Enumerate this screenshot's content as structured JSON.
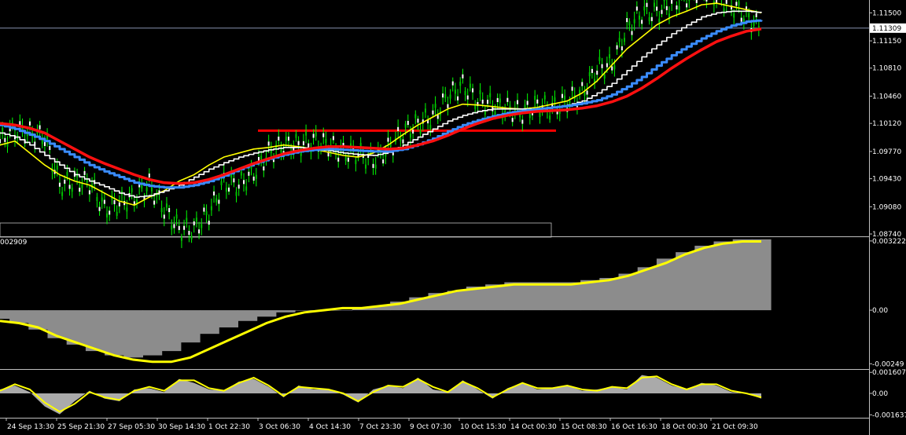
{
  "chart_data": [
    {
      "type": "line",
      "pane": "price",
      "y_ticks": [
        "1.11500",
        "1.11150",
        "1.10810",
        "1.10460",
        "1.10120",
        "1.09770",
        "1.09430",
        "1.09080",
        "1.08740"
      ],
      "y_tick_values": [
        1.115,
        1.1115,
        1.1081,
        1.1046,
        1.1012,
        1.0977,
        1.0943,
        1.0908,
        1.0874
      ],
      "ylim": [
        1.0874,
        1.1166
      ],
      "current_price": "1.11309",
      "current_price_value": 1.11309,
      "horizontal_level": {
        "value": 1.1003,
        "x_from_category": "3 Oct 06:30",
        "x_to_category": "15 Oct 08:30",
        "color": "#ff0000"
      },
      "series": [
        {
          "color": "#00ff00",
          "style": "candles",
          "values": [
            1.099,
            1.1003,
            1.1,
            1.0995,
            1.0935,
            1.094,
            1.0938,
            1.0905,
            1.0912,
            1.092,
            1.0935,
            1.0905,
            1.088,
            1.088,
            1.09,
            1.0938,
            1.0935,
            1.095,
            1.0975,
            1.0985,
            1.0985,
            1.099,
            1.0985,
            1.0975,
            1.0975,
            1.0965,
            1.098,
            1.1,
            1.1012,
            1.102,
            1.1045,
            1.106,
            1.104,
            1.1035,
            1.103,
            1.1025,
            1.1035,
            1.103,
            1.104,
            1.105,
            1.108,
            1.1085,
            1.113,
            1.115,
            1.115,
            1.116,
            1.117,
            1.118,
            1.117,
            1.116,
            1.1145,
            1.113
          ]
        },
        {
          "color": "#ffff00",
          "values": [
            1.0985,
            1.099,
            1.0975,
            1.096,
            1.0948,
            1.094,
            1.0935,
            1.0925,
            1.0915,
            1.091,
            1.092,
            1.0928,
            1.094,
            1.0948,
            1.096,
            1.097,
            1.0975,
            1.098,
            1.0982,
            1.0985,
            1.0983,
            1.098,
            1.0976,
            1.0972,
            1.097,
            1.0975,
            1.0985,
            1.0998,
            1.101,
            1.102,
            1.103,
            1.1036,
            1.1035,
            1.1033,
            1.1031,
            1.103,
            1.1032,
            1.1036,
            1.104,
            1.105,
            1.1065,
            1.1085,
            1.1105,
            1.112,
            1.1135,
            1.1145,
            1.1152,
            1.116,
            1.1162,
            1.1158,
            1.1154,
            1.115
          ]
        },
        {
          "color": "#ffffff",
          "style": "step",
          "values": [
            1.1,
            1.0995,
            1.0985,
            1.0972,
            1.096,
            1.0948,
            1.094,
            1.0933,
            1.0925,
            1.092,
            1.0922,
            1.0928,
            1.0935,
            1.0945,
            1.0955,
            1.0963,
            1.097,
            1.0975,
            1.0979,
            1.0982,
            1.0982,
            1.098,
            1.0978,
            1.0975,
            1.0973,
            1.0972,
            1.0976,
            1.0985,
            1.0995,
            1.1005,
            1.1015,
            1.1022,
            1.1027,
            1.103,
            1.103,
            1.103,
            1.103,
            1.1032,
            1.1035,
            1.104,
            1.105,
            1.1062,
            1.1078,
            1.1095,
            1.111,
            1.1124,
            1.1135,
            1.1145,
            1.115,
            1.1152,
            1.1152,
            1.115
          ]
        },
        {
          "color": "#3a8cff",
          "style": "step",
          "values": [
            1.101,
            1.1005,
            1.0998,
            1.099,
            1.098,
            1.097,
            1.096,
            1.0952,
            1.0945,
            1.0938,
            1.0934,
            1.0932,
            1.0932,
            1.0935,
            1.094,
            1.0947,
            1.0955,
            1.0962,
            1.0968,
            1.0973,
            1.0977,
            1.0979,
            1.098,
            1.0979,
            1.0978,
            1.0977,
            1.0977,
            1.098,
            1.0986,
            1.0993,
            1.1002,
            1.101,
            1.1016,
            1.1021,
            1.1025,
            1.1028,
            1.103,
            1.1032,
            1.1034,
            1.1037,
            1.1041,
            1.1048,
            1.1058,
            1.107,
            1.1084,
            1.1097,
            1.1108,
            1.1118,
            1.1127,
            1.1134,
            1.1139,
            1.1141
          ]
        },
        {
          "color": "#ff1010",
          "values": [
            1.1012,
            1.101,
            1.1006,
            1.1,
            1.099,
            1.098,
            1.097,
            1.0962,
            1.0955,
            1.0948,
            1.0942,
            1.0938,
            1.0937,
            1.0938,
            1.0942,
            1.0948,
            1.0955,
            1.0962,
            1.0968,
            1.0974,
            1.0978,
            1.0981,
            1.0983,
            1.0983,
            1.0982,
            1.0981,
            1.098,
            1.0981,
            1.0985,
            1.099,
            1.0997,
            1.1005,
            1.1012,
            1.1018,
            1.1022,
            1.1025,
            1.1027,
            1.1028,
            1.1029,
            1.1031,
            1.1034,
            1.1039,
            1.1046,
            1.1056,
            1.1068,
            1.1081,
            1.1093,
            1.1104,
            1.1114,
            1.1121,
            1.1127,
            1.113
          ]
        }
      ]
    },
    {
      "type": "area",
      "pane": "oscillator-1",
      "label": "002909",
      "y_ticks": [
        "0.003222",
        "0.00",
        "-0.00249"
      ],
      "y_tick_values": [
        0.003222,
        0.0,
        -0.00249
      ],
      "ylim": [
        -0.0027,
        0.0034
      ],
      "series": [
        {
          "style": "histogram",
          "color": "#8c8c8c",
          "values": [
            -0.0004,
            -0.0006,
            -0.0009,
            -0.0013,
            -0.0016,
            -0.0019,
            -0.0021,
            -0.0022,
            -0.0021,
            -0.0019,
            -0.0015,
            -0.0011,
            -0.0008,
            -0.0005,
            -0.0003,
            -0.0001,
            0.0,
            0.0,
            0.0,
            0.0001,
            0.0002,
            0.0004,
            0.0006,
            0.0008,
            0.0009,
            0.0011,
            0.0012,
            0.0013,
            0.0013,
            0.0013,
            0.0013,
            0.0014,
            0.0015,
            0.0017,
            0.002,
            0.0024,
            0.0027,
            0.003,
            0.0032,
            0.0033,
            0.0033
          ]
        },
        {
          "style": "line",
          "color": "#ffff00",
          "values": [
            -0.0005,
            -0.0006,
            -0.0008,
            -0.0012,
            -0.0015,
            -0.0018,
            -0.0021,
            -0.0023,
            -0.0024,
            -0.0024,
            -0.0022,
            -0.0018,
            -0.0014,
            -0.001,
            -0.0006,
            -0.0003,
            -0.0001,
            0.0,
            0.0001,
            0.0001,
            0.0002,
            0.0003,
            0.0005,
            0.0007,
            0.0009,
            0.001,
            0.0011,
            0.0012,
            0.0012,
            0.0012,
            0.0012,
            0.0013,
            0.0014,
            0.0016,
            0.0019,
            0.0022,
            0.0026,
            0.0029,
            0.0031,
            0.0032,
            0.0032
          ]
        }
      ]
    },
    {
      "type": "area",
      "pane": "oscillator-2",
      "y_ticks": [
        "0.001607",
        "0.00",
        "-0.001637"
      ],
      "y_tick_values": [
        0.001607,
        0.0,
        -0.001637
      ],
      "ylim": [
        -0.0018,
        0.0018
      ],
      "series": [
        {
          "style": "histogram",
          "color": "#aaaaaa",
          "values": [
            0.0003,
            0.0006,
            0.0001,
            -0.001,
            -0.0016,
            -0.0006,
            0.0002,
            -0.0004,
            -0.0006,
            0.0003,
            0.0004,
            0.0001,
            0.0011,
            0.0008,
            0.0003,
            0.0002,
            0.0009,
            0.0011,
            0.0005,
            -0.0003,
            0.0006,
            0.0003,
            0.0003,
            -0.0001,
            -0.0007,
            0.0003,
            0.0006,
            0.0004,
            0.0012,
            0.0003,
            0.0001,
            0.001,
            0.0003,
            -0.0004,
            0.0004,
            0.0008,
            0.0003,
            0.0004,
            0.0006,
            0.0002,
            0.0003,
            0.0005,
            0.0003,
            0.0014,
            0.0012,
            0.0006,
            0.0003,
            0.0008,
            0.0006,
            0.0001,
            0.0,
            -0.0004
          ]
        },
        {
          "style": "line",
          "color": "#ffff00",
          "values": [
            0.0002,
            0.0007,
            0.0003,
            -0.0007,
            -0.0014,
            -0.0008,
            0.0001,
            -0.0003,
            -0.0005,
            0.0002,
            0.0005,
            0.0002,
            0.001,
            0.001,
            0.0004,
            0.0002,
            0.0008,
            0.0012,
            0.0006,
            -0.0002,
            0.0005,
            0.0004,
            0.0003,
            0.0,
            -0.0006,
            0.0001,
            0.0006,
            0.0005,
            0.0011,
            0.0005,
            0.0001,
            0.0009,
            0.0004,
            -0.0003,
            0.0003,
            0.0008,
            0.0004,
            0.0004,
            0.0006,
            0.0003,
            0.0002,
            0.0005,
            0.0004,
            0.0012,
            0.0013,
            0.0007,
            0.0003,
            0.0007,
            0.0007,
            0.0002,
            0.0,
            -0.0003
          ]
        }
      ]
    }
  ],
  "x_axis": {
    "labels": [
      "24 Sep 13:30",
      "25 Sep 21:30",
      "27 Sep 05:30",
      "30 Sep 14:30",
      "1 Oct 22:30",
      "3 Oct 06:30",
      "4 Oct 14:30",
      "7 Oct 23:30",
      "9 Oct 07:30",
      "10 Oct 15:30",
      "14 Oct 00:30",
      "15 Oct 08:30",
      "16 Oct 16:30",
      "18 Oct 00:30",
      "21 Oct 09:30"
    ]
  },
  "colors": {
    "background": "#000000",
    "grid_border": "#c0c0c0",
    "text": "#ffffff"
  }
}
